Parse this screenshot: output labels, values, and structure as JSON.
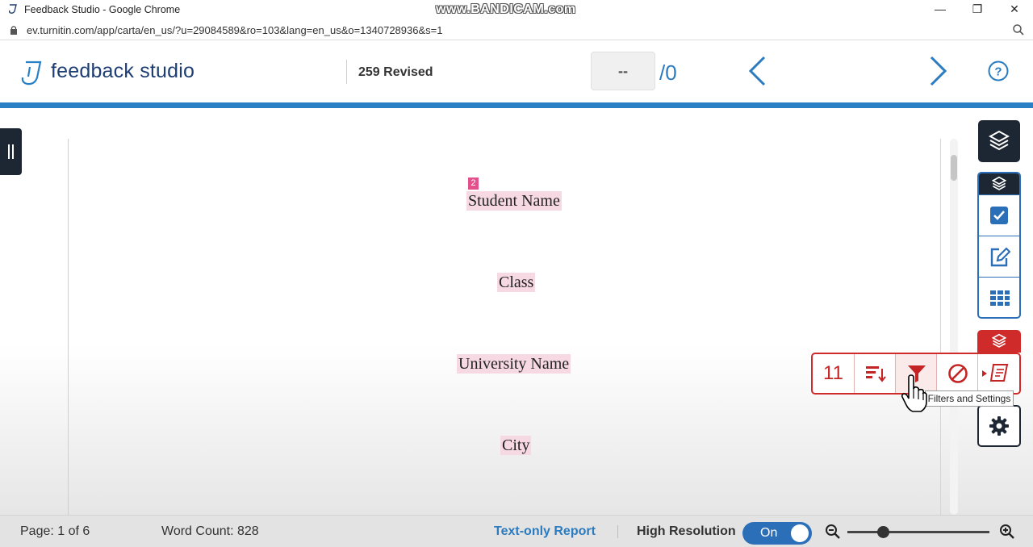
{
  "browser": {
    "tab_title": "Feedback Studio - Google Chrome",
    "watermark": "www.BANDICAM.com",
    "url": "ev.turnitin.com/app/carta/en_us/?u=29084589&ro=103&lang=en_us&o=1340728936&s=1"
  },
  "header": {
    "brand": "feedback studio",
    "document_title": "259 Revised",
    "page_input": "--",
    "page_total": "/0"
  },
  "document": {
    "match_number": "2",
    "lines": [
      "Student Name",
      "Class",
      "University Name",
      "City"
    ]
  },
  "tools": {
    "match_count": "11",
    "tooltip": "Filters and Settings"
  },
  "footer": {
    "page_info": "Page: 1 of 6",
    "word_count": "Word Count: 828",
    "text_only_report": "Text-only Report",
    "high_resolution_label": "High Resolution",
    "high_resolution_state": "On",
    "zoom_level": 0.25
  },
  "colors": {
    "brand_blue": "#2b80c5",
    "brand_navy": "#1d2733",
    "similarity_red": "#d02b2b",
    "highlight_pink": "#f6d9e3"
  }
}
